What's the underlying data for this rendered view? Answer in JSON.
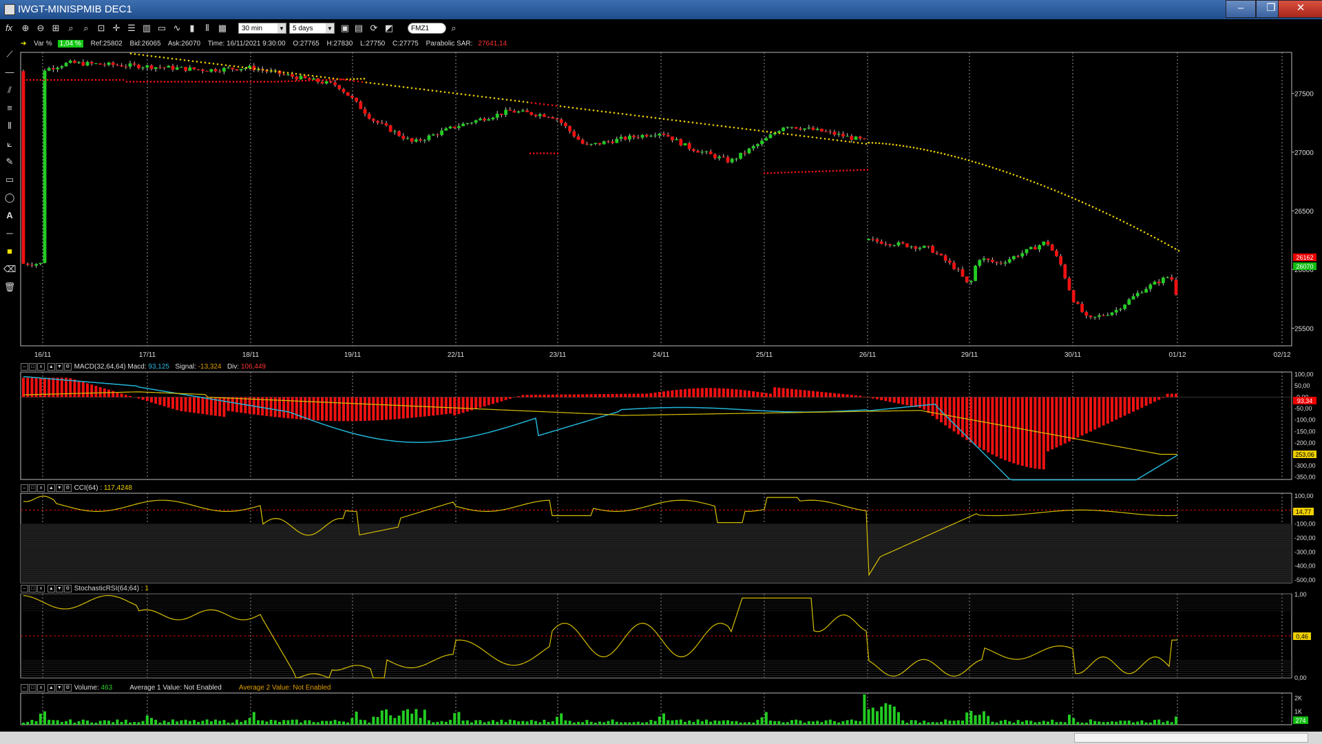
{
  "window": {
    "title": "IWGT-MINISPMIB DEC1",
    "min": "–",
    "max": "❐",
    "close": "✕"
  },
  "toolbar": {
    "interval": "30 min",
    "range": "5 days",
    "symbol": "FMZ1"
  },
  "info": {
    "var_label": "Var %",
    "var_value": "1,04 %",
    "ref": "Ref:25802",
    "bid": "Bid:26065",
    "ask": "Ask:26070",
    "time": "Time: 16/11/2021 9:30:00",
    "open": "O:27765",
    "high": "H:27830",
    "low": "L:27750",
    "close": "C:27775",
    "sar_label": "Parabolic SAR:",
    "sar_value": "27641,14"
  },
  "price_panel": {
    "dates": [
      "16/11",
      "17/11",
      "18/11",
      "19/11",
      "22/11",
      "23/11",
      "24/11",
      "25/11",
      "26/11",
      "29/11",
      "30/11",
      "01/12",
      "02/12"
    ],
    "yticks": [
      "27500",
      "27000",
      "26500",
      "26000",
      "25500"
    ],
    "last_red": "26162",
    "last_green": "26070"
  },
  "macd": {
    "name": "MACD(32,64,64)",
    "macd_label": "Macd:",
    "macd": "93,125",
    "signal_label": "Signal:",
    "signal": "-13,324",
    "div_label": "Div:",
    "div": "106,449",
    "yticks": [
      "100,00",
      "50,00",
      "-0,00",
      "-50,00",
      "-100,00",
      "-150,00",
      "-200,00",
      "-250,00",
      "-300,00",
      "-350,00"
    ],
    "last_red": "93,34",
    "last_yellow": "253,06"
  },
  "cci": {
    "name": "CCI(64) :",
    "value": "117,4248",
    "yticks": [
      "100,00",
      "0,00",
      "-100,00",
      "-200,00",
      "-300,00",
      "-400,00",
      "-500,00"
    ],
    "last": "14,77"
  },
  "stoch": {
    "name": "StochasticRSI(64;64) :",
    "value": "1",
    "yticks": [
      "1,00",
      "0,00"
    ],
    "last": "0,46"
  },
  "volume": {
    "name": "Volume:",
    "value": "463",
    "avg1_label": "Average 1 Value:",
    "avg1": "Not Enabled",
    "avg2_label": "Average 2 Value:",
    "avg2": "Not Enabled",
    "yticks": [
      "2K",
      "1K"
    ],
    "last": "274"
  },
  "colors": {
    "up": "#22cc22",
    "down": "#ee1111",
    "sar": "#e6c800",
    "macd_line": "#22b5d8",
    "signal_line": "#d8c000",
    "grid": "#999999"
  }
}
